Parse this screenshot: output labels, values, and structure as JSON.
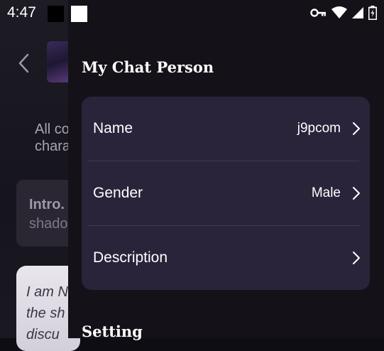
{
  "status_bar": {
    "time": "4:47",
    "icons": [
      "vpn-key-icon",
      "wifi-icon",
      "cell-signal-icon",
      "battery-icon"
    ]
  },
  "background_app": {
    "text_line1": "All co",
    "text_line2": "chara",
    "card_title": "Intro.",
    "card_subtitle": "shado",
    "bubble_line1": "I am N",
    "bubble_line2": "the sh",
    "bubble_line3": "discu"
  },
  "drawer": {
    "title": "My Chat Person",
    "rows": [
      {
        "label": "Name",
        "value": "j9pcom"
      },
      {
        "label": "Gender",
        "value": "Male"
      },
      {
        "label": "Description",
        "value": ""
      }
    ],
    "section_title": "Setting"
  },
  "colors": {
    "drawer_bg": "#141218",
    "card_bg": "#29243a",
    "divider": "#3f3a52"
  }
}
